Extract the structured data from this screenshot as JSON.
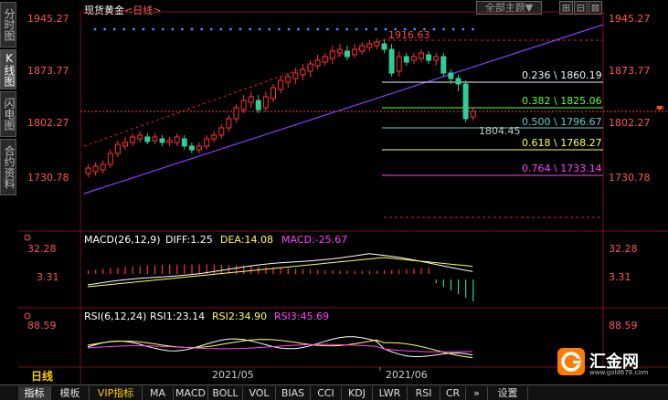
{
  "window": {
    "title": "现货黄金",
    "period_link": "<日线>",
    "theme_select": "全部主题▼"
  },
  "left_tabs": [
    {
      "label": "分时图",
      "active": false
    },
    {
      "label": "K线图",
      "active": true
    },
    {
      "label": "闪电图",
      "active": false
    },
    {
      "label": "合约资料",
      "active": false
    }
  ],
  "top_buttons": [
    "⊞",
    "⊟",
    "⊠"
  ],
  "price_axis": {
    "left": [
      "1945.27",
      "1873.77",
      "1802.27",
      "1730.78"
    ],
    "right": [
      "1945.27",
      "1873.77",
      "1802.27",
      "1730.78"
    ]
  },
  "fib_labels": {
    "high": "1916.63",
    "low": "1804.45",
    "levels": [
      {
        "text": "0.236 \\ 1860.19",
        "color": "#e8f4ff"
      },
      {
        "text": "0.382 \\ 1825.06",
        "color": "#66ff33"
      },
      {
        "text": "0.500 \\ 1796.67",
        "color": "#66cccc"
      },
      {
        "text": "0.618 \\ 1768.27",
        "color": "#ffff55"
      },
      {
        "text": "0.764 \\ 1733.14",
        "color": "#ff44ff"
      }
    ]
  },
  "macd": {
    "title": "MACD(26,12,9)",
    "diff": "DIFF:1.25",
    "dea": "DEA:14.08",
    "macd": "MACD:-25.67",
    "axis": [
      "32.28",
      "3.31"
    ]
  },
  "rsi": {
    "title": "RSI(6,12,24)",
    "rsi1": "RSI1:23.14",
    "rsi2": "RSI2:34.90",
    "rsi3": "RSI3:45.69",
    "axis": [
      "88.59"
    ]
  },
  "x_axis": {
    "label1": "2021/05",
    "label2": "2021/06"
  },
  "period_label": "日线",
  "bottom_tabs": [
    "指标",
    "模板",
    "VIP指标",
    "MA",
    "MACD",
    "BOLL",
    "VOL",
    "BIAS",
    "CCI",
    "KDJ",
    "LWR",
    "RSI",
    "CR",
    "»",
    "设置"
  ],
  "logo": {
    "name": "汇金网",
    "url": "www.gold678.com"
  },
  "colors": {
    "up": "#ff3333",
    "down": "#33cc99",
    "purple": "#8a3cff",
    "gold": "#ffcc00"
  }
}
